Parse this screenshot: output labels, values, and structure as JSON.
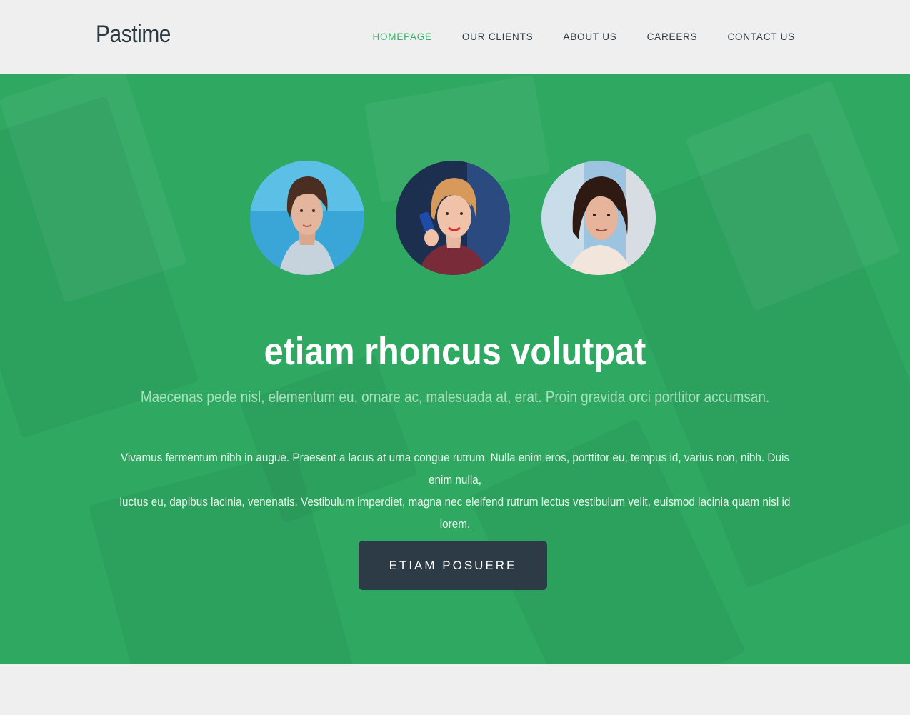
{
  "header": {
    "logo": "Pastime",
    "nav": [
      {
        "label": "HOMEPAGE",
        "active": true
      },
      {
        "label": "OUR CLIENTS",
        "active": false
      },
      {
        "label": "ABOUT US",
        "active": false
      },
      {
        "label": "CAREERS",
        "active": false
      },
      {
        "label": "CONTACT US",
        "active": false
      }
    ]
  },
  "hero": {
    "title": "etiam rhoncus volutpat",
    "subtitle": "Maecenas pede nisl, elementum eu, ornare ac, malesuada at, erat. Proin gravida orci porttitor accumsan.",
    "body_line1": "Vivamus fermentum nibh in augue. Praesent a lacus at urna congue rutrum. Nulla enim eros, porttitor eu, tempus id, varius non, nibh. Duis enim nulla,",
    "body_line2": "luctus eu, dapibus lacinia, venenatis. Vestibulum imperdiet, magna nec eleifend rutrum lectus vestibulum velit, euismod lacinia quam nisl id lorem.",
    "cta_label": "ETIAM POSUERE",
    "avatars": [
      {
        "name": "avatar-woman-1"
      },
      {
        "name": "avatar-woman-2"
      },
      {
        "name": "avatar-woman-3"
      }
    ]
  },
  "colors": {
    "accent": "#37b06a",
    "hero_bg": "#2fa862",
    "dark": "#2c3b45",
    "page_bg": "#efefef"
  }
}
